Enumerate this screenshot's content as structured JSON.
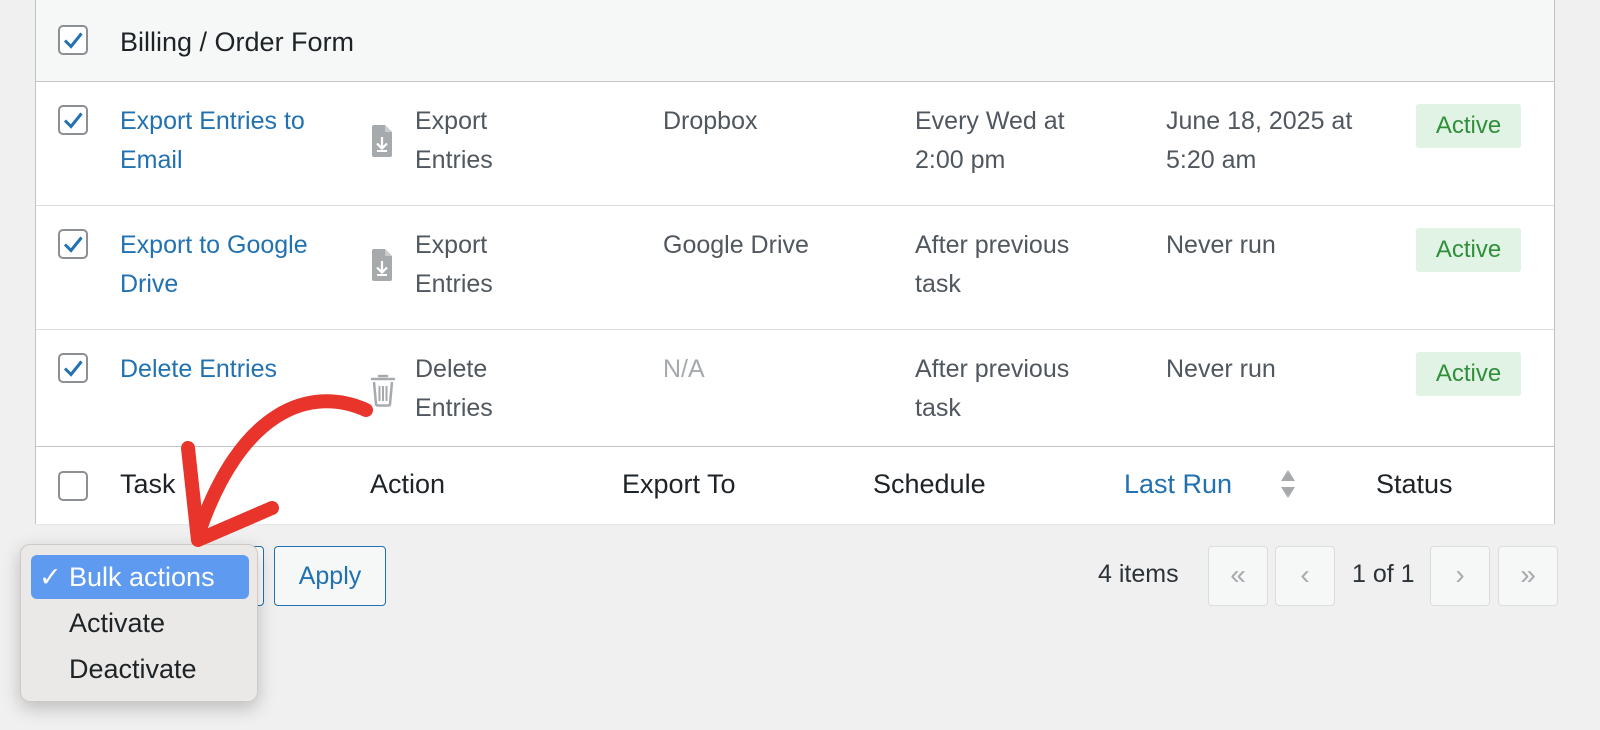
{
  "group": {
    "title": "Billing / Order Form",
    "checked": true
  },
  "rows": [
    {
      "task_line1": "Export Entries to",
      "task_line2": "Email",
      "action_line1": "Export",
      "action_line2": "Entries",
      "action_icon": "file-export-icon",
      "export_to": "Dropbox",
      "schedule_line1": "Every Wed at",
      "schedule_line2": "2:00 pm",
      "last_run_line1": "June 18, 2025 at",
      "last_run_line2": "5:20 am",
      "status": "Active",
      "checked": true
    },
    {
      "task_line1": "Export to Google",
      "task_line2": "Drive",
      "action_line1": "Export",
      "action_line2": "Entries",
      "action_icon": "file-export-icon",
      "export_to": "Google Drive",
      "schedule_line1": "After previous",
      "schedule_line2": "task",
      "last_run_line1": "Never run",
      "last_run_line2": "",
      "status": "Active",
      "checked": true
    },
    {
      "task_line1": "Delete Entries",
      "task_line2": "",
      "action_line1": "Delete",
      "action_line2": "Entries",
      "action_icon": "trash-icon",
      "export_to": "N/A",
      "schedule_line1": "After previous",
      "schedule_line2": "task",
      "last_run_line1": "Never run",
      "last_run_line2": "",
      "status": "Active",
      "checked": true
    }
  ],
  "columns": {
    "task": "Task",
    "action": "Action",
    "export_to": "Export To",
    "schedule": "Schedule",
    "last_run": "Last Run",
    "status": "Status"
  },
  "bulk": {
    "options": [
      {
        "label": "Bulk actions",
        "selected": true
      },
      {
        "label": "Activate",
        "selected": false
      },
      {
        "label": "Deactivate",
        "selected": false
      }
    ],
    "check_mark": "✓",
    "apply_label": "Apply"
  },
  "pagination": {
    "items": "4 items",
    "first": "«",
    "prev": "‹",
    "page_of": "1 of 1",
    "next": "›",
    "last": "»"
  },
  "colors": {
    "link": "#2271b1",
    "active_badge_bg": "#e1f3e4",
    "active_badge_text": "#2f8f3a",
    "dropdown_selected": "#5e9af0",
    "annotation_arrow": "#e8342a"
  }
}
